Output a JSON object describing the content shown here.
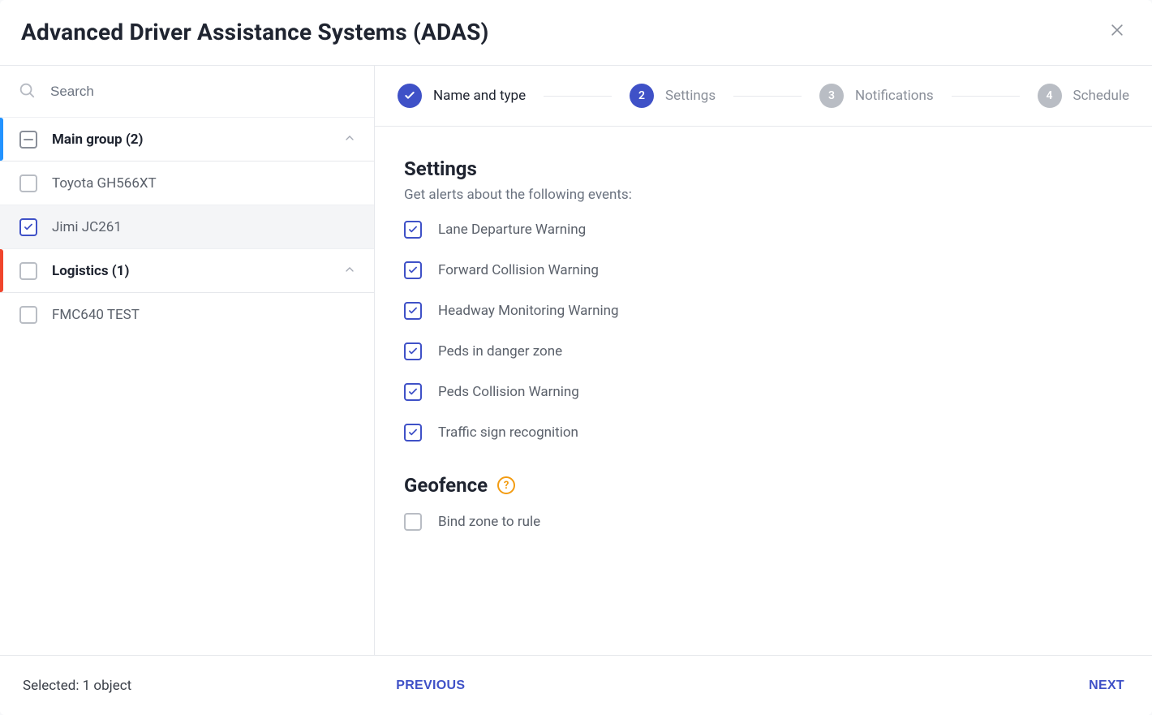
{
  "header": {
    "title": "Advanced Driver Assistance Systems (ADAS)"
  },
  "search": {
    "placeholder": "Search"
  },
  "sidebar": {
    "groups": [
      {
        "label": "Main group (2)",
        "state": "mixed",
        "accent": "blue",
        "items": [
          {
            "label": "Toyota GH566XT",
            "checked": false,
            "selected": false
          },
          {
            "label": "Jimi JC261",
            "checked": true,
            "selected": true
          }
        ]
      },
      {
        "label": "Logistics (1)",
        "state": "unchecked",
        "accent": "red",
        "items": [
          {
            "label": "FMC640 TEST",
            "checked": false,
            "selected": false
          }
        ]
      }
    ]
  },
  "steps": [
    {
      "name": "Name and type",
      "state": "done"
    },
    {
      "name": "Settings",
      "state": "active",
      "num": "2"
    },
    {
      "name": "Notifications",
      "state": "inactive",
      "num": "3"
    },
    {
      "name": "Schedule",
      "state": "inactive",
      "num": "4"
    }
  ],
  "settings": {
    "title": "Settings",
    "subtitle": "Get alerts about the following events:",
    "options": [
      {
        "label": "Lane Departure Warning",
        "checked": true
      },
      {
        "label": "Forward Collision Warning",
        "checked": true
      },
      {
        "label": "Headway Monitoring Warning",
        "checked": true
      },
      {
        "label": "Peds in danger zone",
        "checked": true
      },
      {
        "label": "Peds Collision Warning",
        "checked": true
      },
      {
        "label": "Traffic sign recognition",
        "checked": true
      }
    ],
    "geofence": {
      "title": "Geofence",
      "bind_label": "Bind zone to rule",
      "bind_checked": false
    }
  },
  "footer": {
    "status": "Selected: 1 object",
    "previous": "PREVIOUS",
    "next": "NEXT"
  }
}
